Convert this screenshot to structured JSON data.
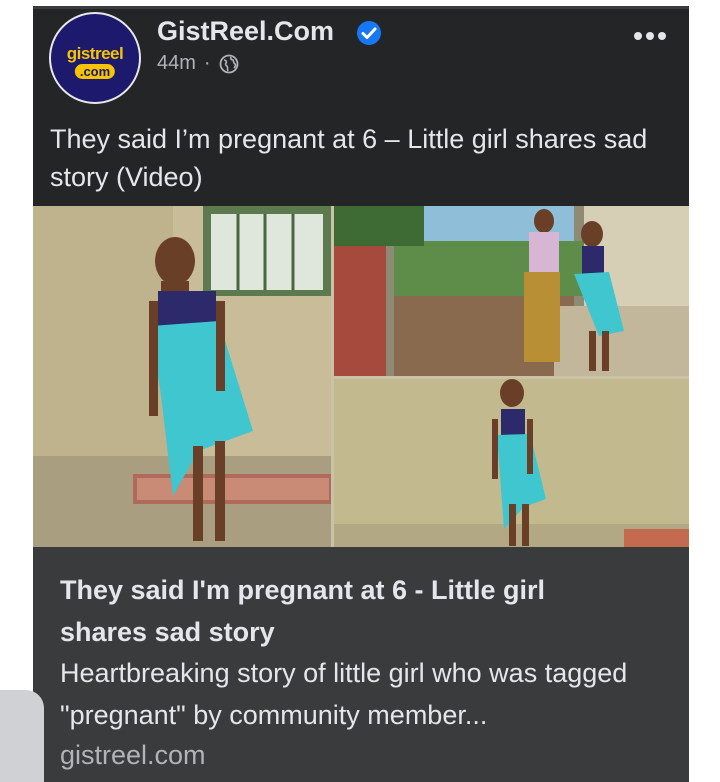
{
  "post": {
    "page_name": "GistReel.Com",
    "time_ago": "44m",
    "separator": "·",
    "privacy_icon": "globe-icon",
    "verified_icon": "verified-badge-icon",
    "more_icon": "more-horizontal-icon",
    "avatar": {
      "logo_top": "gistreel",
      "logo_bottom": ".com"
    },
    "caption": "They said I’m pregnant at 6 – Little girl shares sad story (Video)"
  },
  "link_preview": {
    "title": "They said I'm pregnant at 6 - Little girl shares sad story",
    "description": "Heartbreaking story of little girl who was tagged \"pregnant\" by community member...",
    "domain": "gistreel.com"
  },
  "colors": {
    "post_bg": "#242526",
    "card_bg": "#3a3b3c",
    "text_primary": "#e4e6eb",
    "text_secondary": "#b0b3b8",
    "verified_blue": "#1877f2",
    "avatar_bg": "#1d1a6e",
    "avatar_accent": "#f6c400"
  }
}
